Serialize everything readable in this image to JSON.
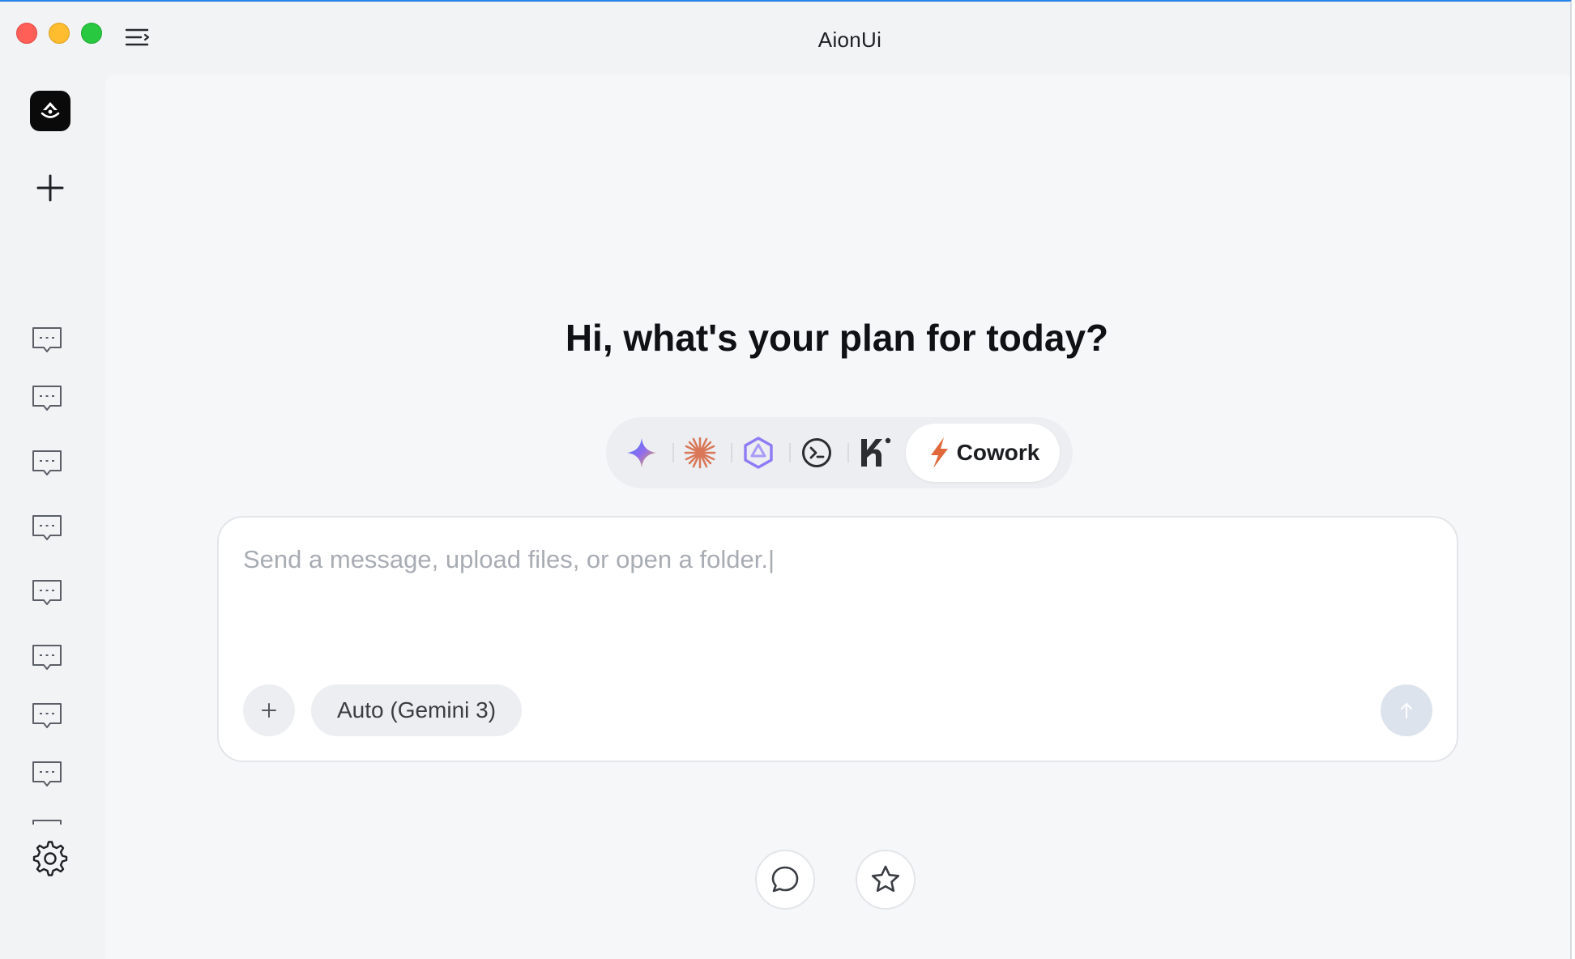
{
  "window": {
    "title": "AionUi",
    "controls": [
      "close",
      "minimize",
      "zoom"
    ]
  },
  "sidebar": {
    "logo_icon": "aion-logo-icon",
    "new_chat_icon": "plus-icon",
    "conversations": [
      {
        "icon": "chat-bubble-icon"
      },
      {
        "icon": "chat-bubble-icon"
      },
      {
        "icon": "chat-bubble-icon"
      },
      {
        "icon": "chat-bubble-icon"
      },
      {
        "icon": "chat-bubble-icon"
      },
      {
        "icon": "chat-bubble-icon"
      },
      {
        "icon": "chat-bubble-icon"
      },
      {
        "icon": "chat-bubble-icon"
      },
      {
        "icon": "chat-bubble-icon"
      },
      {
        "icon": "chat-bubble-icon"
      }
    ],
    "settings_icon": "gear-icon"
  },
  "main": {
    "greeting": "Hi, what's your plan for today?",
    "agents": [
      {
        "icon": "gemini-sparkle-icon",
        "color": "#4a8cf7"
      },
      {
        "icon": "claude-starburst-icon",
        "color": "#d97757"
      },
      {
        "icon": "qwen-hexagon-icon",
        "color": "#8d7cf6"
      },
      {
        "icon": "terminal-circle-icon",
        "color": "#2b2d31"
      },
      {
        "icon": "kimi-k-icon",
        "color": "#2b2d31"
      }
    ],
    "active_agent": {
      "icon": "lightning-icon",
      "label": "Cowork",
      "color": "#e0683a"
    },
    "composer": {
      "placeholder": "Send a message, upload files, or open a folder.|",
      "value": "",
      "attach_icon": "plus-icon",
      "model_label": "Auto (Gemini 3)",
      "send_icon": "arrow-up-icon"
    },
    "bottom_actions": [
      {
        "icon": "chat-icon"
      },
      {
        "icon": "star-icon"
      }
    ]
  }
}
